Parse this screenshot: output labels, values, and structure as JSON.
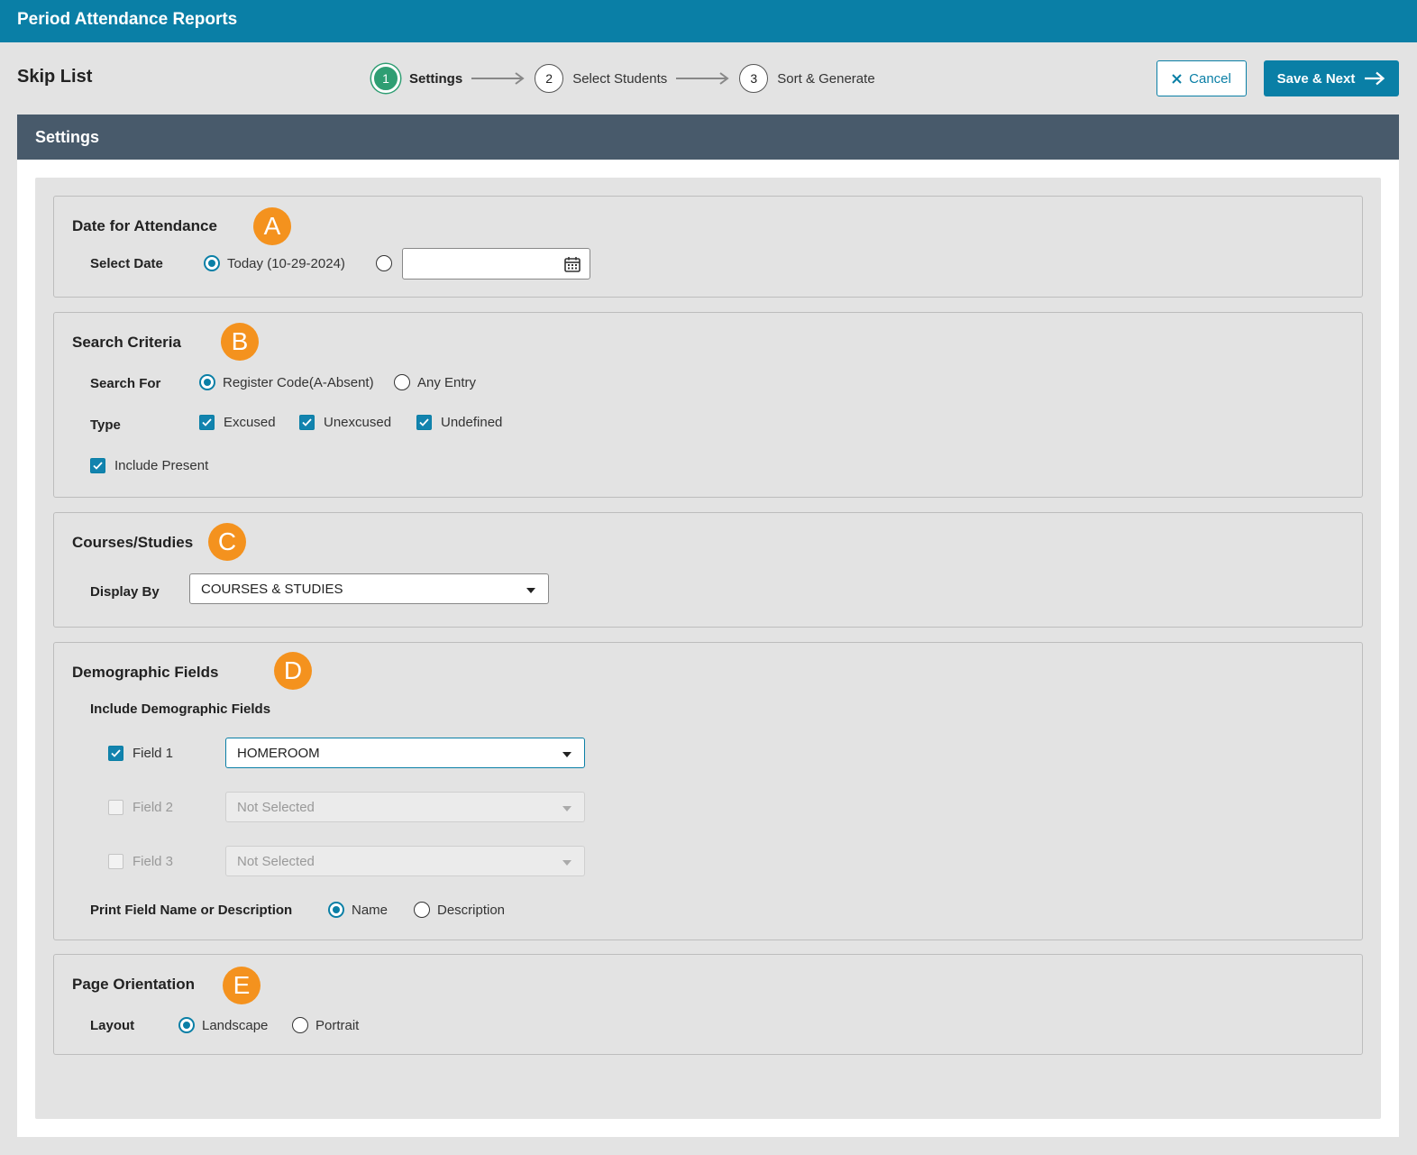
{
  "app": {
    "title": "Period Attendance Reports"
  },
  "page": {
    "title": "Skip List"
  },
  "stepper": {
    "steps": [
      {
        "number": "1",
        "label": "Settings",
        "active": true
      },
      {
        "number": "2",
        "label": "Select Students",
        "active": false
      },
      {
        "number": "3",
        "label": "Sort & Generate",
        "active": false
      }
    ]
  },
  "actions": {
    "cancel_label": "Cancel",
    "save_label": "Save & Next"
  },
  "settings": {
    "header": "Settings",
    "date_section": {
      "title": "Date for Attendance",
      "badge": "A",
      "select_date_label": "Select Date",
      "today_option": "Today (10-29-2024)",
      "today_selected": true,
      "custom_date_value": ""
    },
    "search_section": {
      "title": "Search Criteria",
      "badge": "B",
      "search_for_label": "Search For",
      "search_options": [
        "Register Code(A-Absent)",
        "Any Entry"
      ],
      "search_selected": "Register Code(A-Absent)",
      "type_label": "Type",
      "types": [
        {
          "label": "Excused",
          "checked": true
        },
        {
          "label": "Unexcused",
          "checked": true
        },
        {
          "label": "Undefined",
          "checked": true
        }
      ],
      "include_present_label": "Include Present",
      "include_present_checked": true
    },
    "courses_section": {
      "title": "Courses/Studies",
      "badge": "C",
      "display_by_label": "Display By",
      "display_by_value": "COURSES & STUDIES"
    },
    "demographic_section": {
      "title": "Demographic Fields",
      "badge": "D",
      "include_label": "Include Demographic Fields",
      "fields": [
        {
          "label": "Field 1",
          "checked": true,
          "value": "HOMEROOM"
        },
        {
          "label": "Field 2",
          "checked": false,
          "value": "Not Selected"
        },
        {
          "label": "Field 3",
          "checked": false,
          "value": "Not Selected"
        }
      ],
      "print_label": "Print Field Name or Description",
      "print_options": [
        "Name",
        "Description"
      ],
      "print_selected": "Name"
    },
    "orientation_section": {
      "title": "Page Orientation",
      "badge": "E",
      "layout_label": "Layout",
      "layout_options": [
        "Landscape",
        "Portrait"
      ],
      "layout_selected": "Landscape"
    }
  },
  "colors": {
    "topbar": "#0a7fa6",
    "settings_header": "#485a6b",
    "badge": "#f4921e",
    "active_step": "#2f9e73"
  }
}
